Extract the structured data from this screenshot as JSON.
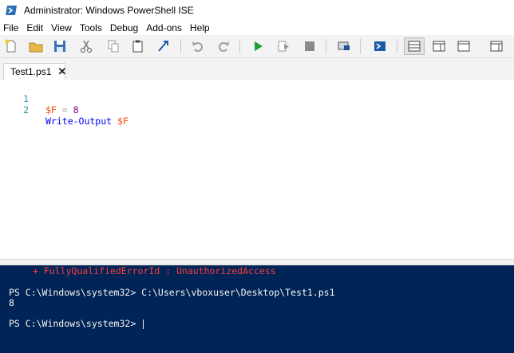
{
  "window": {
    "title": "Administrator: Windows PowerShell ISE"
  },
  "menu": [
    "File",
    "Edit",
    "View",
    "Tools",
    "Debug",
    "Add-ons",
    "Help"
  ],
  "toolbar": {
    "buttons": [
      "new-icon",
      "open-icon",
      "save-icon",
      "cut-icon",
      "copy-icon",
      "paste-icon",
      "clear-console-icon",
      "undo-icon",
      "redo-icon",
      "run-icon",
      "run-selection-icon",
      "stop-icon",
      "remote-session-icon",
      "powershell-console-icon",
      "layout-top-icon",
      "layout-right-icon",
      "layout-max-icon",
      "layout-extra-icon"
    ]
  },
  "tab": {
    "label": "Test1.ps1",
    "close": "✕"
  },
  "editor": {
    "lines": [
      {
        "num": "1",
        "var": "$F",
        "op": " = ",
        "value": "8"
      },
      {
        "num": "2",
        "cmd": "Write-Output",
        "arg": "$F"
      }
    ]
  },
  "console": {
    "error": "+ FullyQualifiedErrorId : UnauthorizedAccess",
    "prompt1": "PS C:\\Windows\\system32> C:\\Users\\vboxuser\\Desktop\\Test1.ps1",
    "output": "8",
    "prompt2": "PS C:\\Windows\\system32> "
  },
  "colors": {
    "console_bg": "#012456",
    "error": "#ff3b3b",
    "variable": "#ff4500",
    "command": "#0000ff",
    "line_number": "#2b91af"
  }
}
